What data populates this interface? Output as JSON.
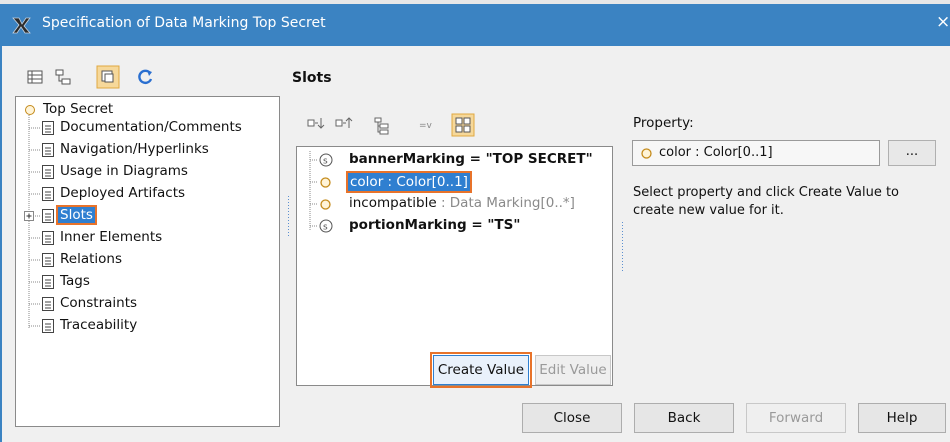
{
  "window": {
    "title": "Specification of Data Marking Top Secret",
    "close_glyph": "×"
  },
  "toolbar": {
    "icons": [
      "list-view-icon",
      "tree-view-icon",
      "compact-view-icon",
      "refresh-icon"
    ]
  },
  "tree": {
    "root_label": "Top Secret",
    "items": [
      {
        "label": "Documentation/Comments"
      },
      {
        "label": "Navigation/Hyperlinks"
      },
      {
        "label": "Usage in Diagrams"
      },
      {
        "label": "Deployed Artifacts"
      },
      {
        "label": "Slots",
        "selected": true,
        "expandable": true
      },
      {
        "label": "Inner Elements"
      },
      {
        "label": "Relations"
      },
      {
        "label": "Tags"
      },
      {
        "label": "Constraints"
      },
      {
        "label": "Traceability"
      }
    ]
  },
  "slots_panel": {
    "title": "Slots",
    "toolbar_icons": [
      "expand-all-icon",
      "collapse-all-icon",
      "tree-structure-icon",
      "filter-icon",
      "grid-view-icon"
    ],
    "items": [
      {
        "name": "bannerMarking",
        "value": " = \"TOP SECRET\"",
        "bold": true,
        "icon": "slot-value-icon"
      },
      {
        "name": "color",
        "type": " : Color[0..1]",
        "selected": true,
        "icon": "property-icon"
      },
      {
        "name": "incompatible",
        "type": " : Data Marking[0..*]",
        "icon": "property-icon"
      },
      {
        "name": "portionMarking",
        "value": " = \"TS\"",
        "bold": true,
        "icon": "slot-value-icon"
      }
    ],
    "create_value_label": "Create Value",
    "edit_value_label": "Edit Value"
  },
  "property": {
    "label": "Property:",
    "value": "color : Color[0..1]",
    "browse_label": "...",
    "hint": "Select property and click Create Value to create new value for it."
  },
  "footer": {
    "close_label": "Close",
    "back_label": "Back",
    "forward_label": "Forward",
    "help_label": "Help"
  },
  "colors": {
    "titlebar": "#3b83c2",
    "selection": "#2f7fd0",
    "highlight_outline": "#e8732a"
  }
}
